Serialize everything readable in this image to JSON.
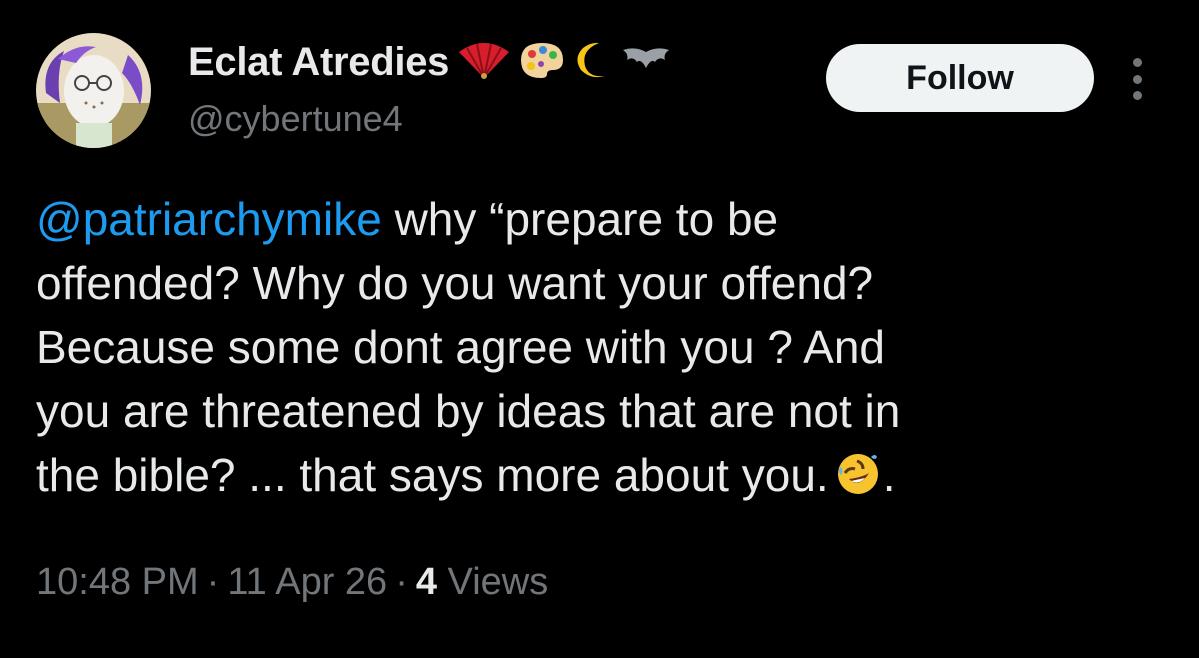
{
  "author": {
    "display_name": "Eclat Atredies",
    "name_emojis": [
      "fan-emoji",
      "palette-emoji",
      "crescent-moon-emoji",
      "bat-emoji"
    ],
    "handle": "@cybertune4",
    "avatar": "avatar-illustration"
  },
  "follow_label": "Follow",
  "more_icon": "more-vertical-icon",
  "tweet": {
    "mention": "@patriarchymike",
    "line1_rest": " why “prepare to be",
    "line2": "offended? Why do you want your offend?",
    "line3": "Because some dont agree with you ? And",
    "line4": "you are threatened by ideas that are not in",
    "line5_text": "the bible? ... that says more about you.",
    "line5_emoji": "rolling-on-floor-laughing-emoji",
    "line5_end": "."
  },
  "meta": {
    "time": "10:48 PM",
    "separator": "·",
    "date": "11 Apr 26",
    "views_count": "4",
    "views_label": "Views"
  },
  "colors": {
    "background": "#000000",
    "text": "#e7e9ea",
    "secondary": "#71767b",
    "link": "#1d9bf0",
    "follow_bg": "#eff3f4"
  }
}
